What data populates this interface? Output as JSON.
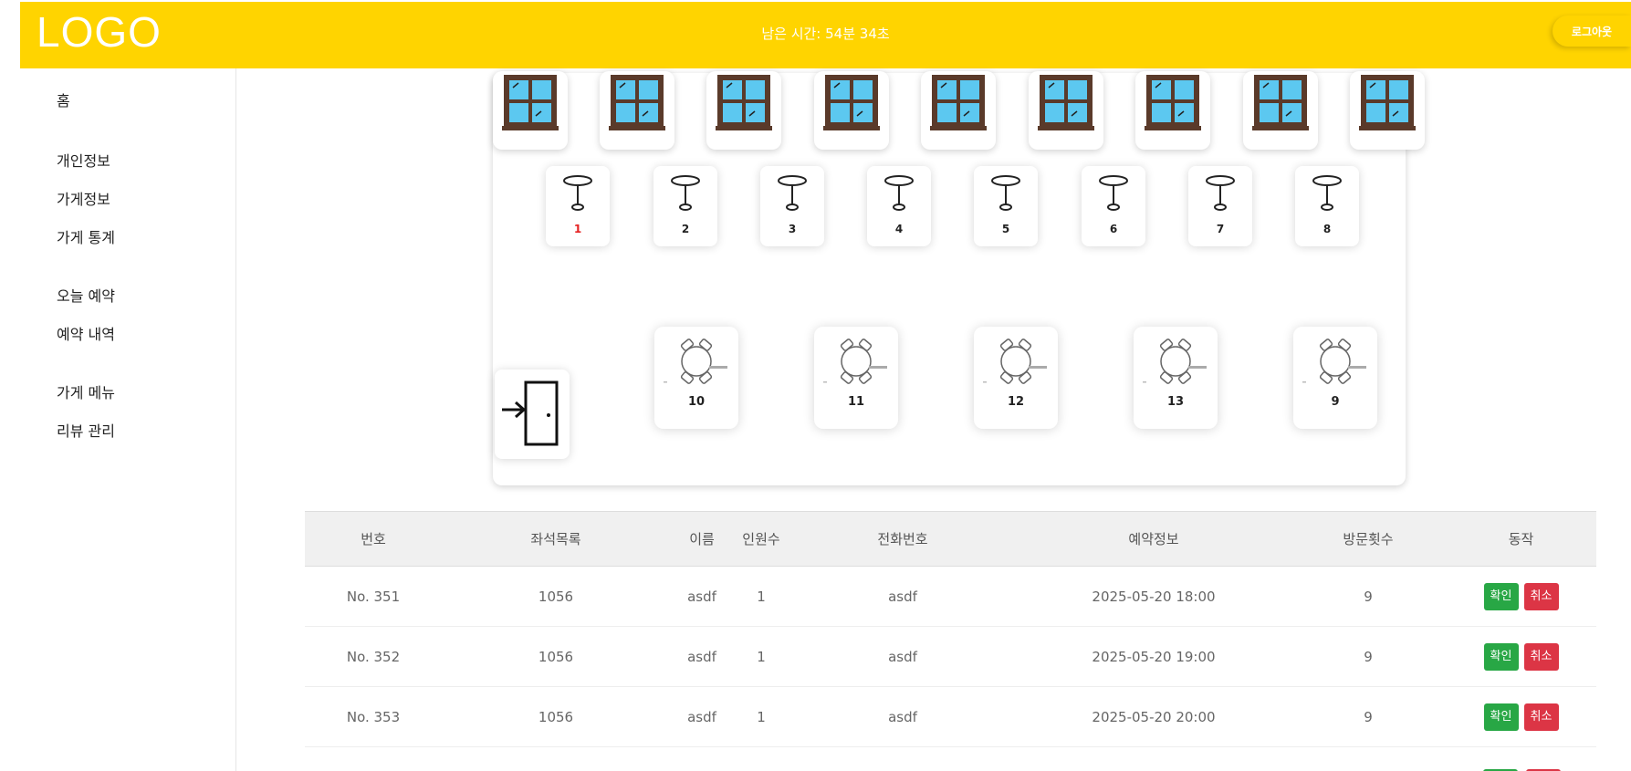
{
  "header": {
    "logo": "LOGO",
    "timer": "남은 시간: 54분 34초",
    "logout_label": "로그아웃"
  },
  "sidebar": {
    "items": [
      {
        "label": "홈"
      },
      {
        "label": "개인정보"
      },
      {
        "label": "가게정보"
      },
      {
        "label": "가게 통계"
      },
      {
        "label": "오늘 예약"
      },
      {
        "label": "예약 내역"
      },
      {
        "label": "가게 메뉴"
      },
      {
        "label": "리뷰 관리"
      }
    ]
  },
  "seat_map": {
    "window_count": 9,
    "icons": {
      "window": "window-icon",
      "table": "round-table-icon",
      "table_set": "table-with-chairs-icon",
      "door": "entrance-door-icon"
    },
    "small_tables": [
      {
        "label": "1",
        "selected": true
      },
      {
        "label": "2"
      },
      {
        "label": "3"
      },
      {
        "label": "4"
      },
      {
        "label": "5"
      },
      {
        "label": "6"
      },
      {
        "label": "7"
      },
      {
        "label": "8"
      }
    ],
    "large_tables": [
      {
        "label": "10"
      },
      {
        "label": "11"
      },
      {
        "label": "12"
      },
      {
        "label": "13"
      },
      {
        "label": "9"
      }
    ]
  },
  "reservations": {
    "columns": [
      "번호",
      "좌석목록",
      "이름",
      "인원수",
      "전화번호",
      "예약정보",
      "방문횟수",
      "동작"
    ],
    "rows": [
      {
        "no": "No. 351",
        "seats": "1056",
        "name": "asdf",
        "people": "1",
        "phone": "asdf",
        "datetime": "2025-05-20 18:00",
        "visits": "9"
      },
      {
        "no": "No. 352",
        "seats": "1056",
        "name": "asdf",
        "people": "1",
        "phone": "asdf",
        "datetime": "2025-05-20 19:00",
        "visits": "9"
      },
      {
        "no": "No. 353",
        "seats": "1056",
        "name": "asdf",
        "people": "1",
        "phone": "asdf",
        "datetime": "2025-05-20 20:00",
        "visits": "9"
      }
    ],
    "confirm_label": "확인",
    "cancel_label": "취소"
  },
  "colors": {
    "header": "#ffd400",
    "selected_table": "#e52222",
    "confirm": "#28a745",
    "cancel": "#dc3545",
    "window_glass": "#5cc8f0",
    "window_frame": "#5a3a2a"
  }
}
